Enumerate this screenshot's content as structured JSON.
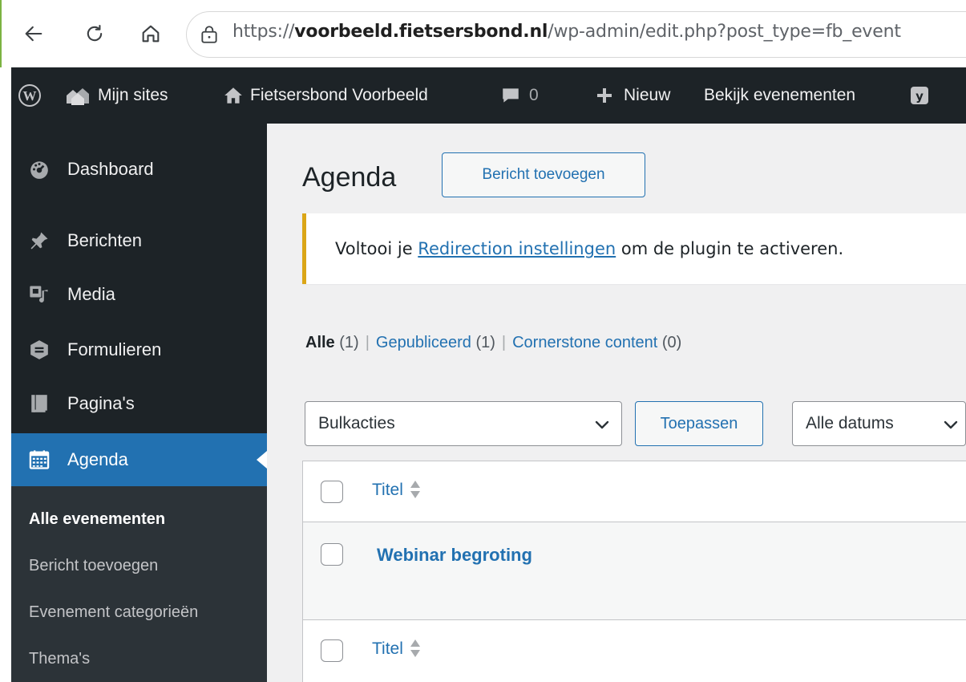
{
  "browser": {
    "url_scheme": "https://",
    "url_host": "voorbeeld.fietsersbond.nl",
    "url_path": "/wp-admin/edit.php?post_type=fb_event"
  },
  "adminbar": {
    "my_sites": "Mijn sites",
    "site_name": "Fietsersbond Voorbeeld",
    "comments_count": "0",
    "new_label": "Nieuw",
    "view_label": "Bekijk evenementen"
  },
  "sidebar": {
    "items": [
      {
        "label": "Dashboard",
        "icon": "dashboard-icon"
      },
      {
        "label": "Berichten",
        "icon": "pin-icon"
      },
      {
        "label": "Media",
        "icon": "media-icon"
      },
      {
        "label": "Formulieren",
        "icon": "forms-icon"
      },
      {
        "label": "Pagina's",
        "icon": "pages-icon"
      },
      {
        "label": "Agenda",
        "icon": "calendar-icon"
      }
    ],
    "submenu": [
      {
        "label": "Alle evenementen"
      },
      {
        "label": "Bericht toevoegen"
      },
      {
        "label": "Evenement categorieën"
      },
      {
        "label": "Thema's"
      }
    ]
  },
  "main": {
    "title": "Agenda",
    "add_button": "Bericht toevoegen",
    "notice": {
      "prefix": "Voltooi je ",
      "link": "Redirection instellingen",
      "suffix": " om de plugin te activeren."
    },
    "views": [
      {
        "label": "Alle",
        "count": "(1)"
      },
      {
        "label": "Gepubliceerd",
        "count": "(1)"
      },
      {
        "label": "Cornerstone content",
        "count": "(0)"
      }
    ],
    "bulk_select": "Bulkacties",
    "apply_button": "Toepassen",
    "dates_select": "Alle datums",
    "table": {
      "column_title": "Titel",
      "rows": [
        {
          "title": "Webinar begroting"
        }
      ]
    }
  },
  "colors": {
    "admin_dark": "#1d2327",
    "accent_blue": "#2271b1",
    "notice_yellow": "#dba617"
  }
}
